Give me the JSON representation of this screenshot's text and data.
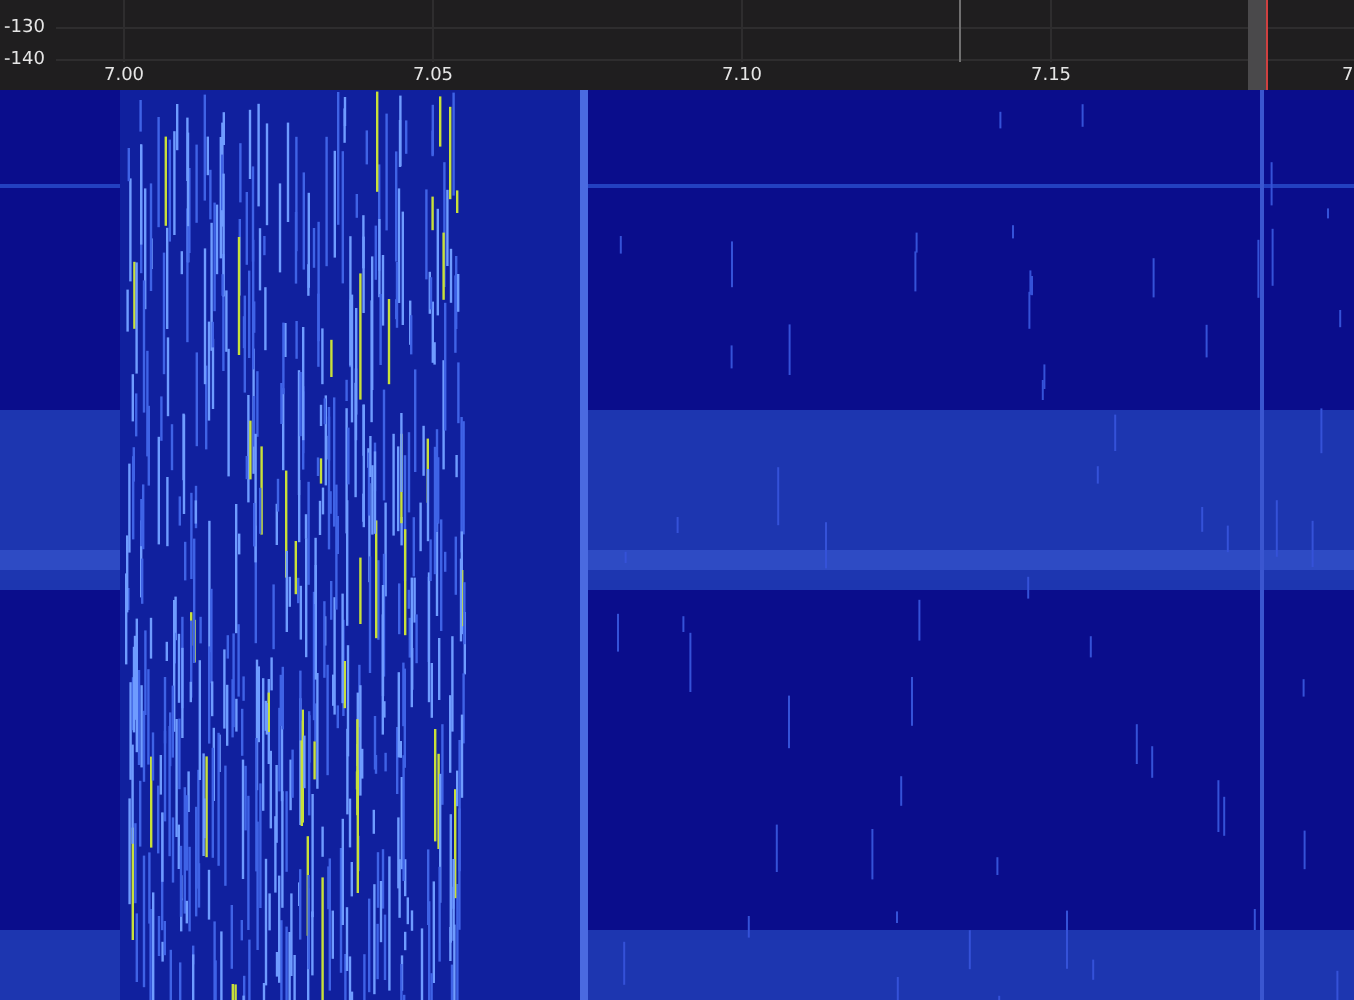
{
  "spectrum": {
    "y_ticks": [
      "-130",
      "-140"
    ],
    "x_ticks": [
      "7.00",
      "7.05",
      "7.10",
      "7.15",
      "7"
    ]
  }
}
